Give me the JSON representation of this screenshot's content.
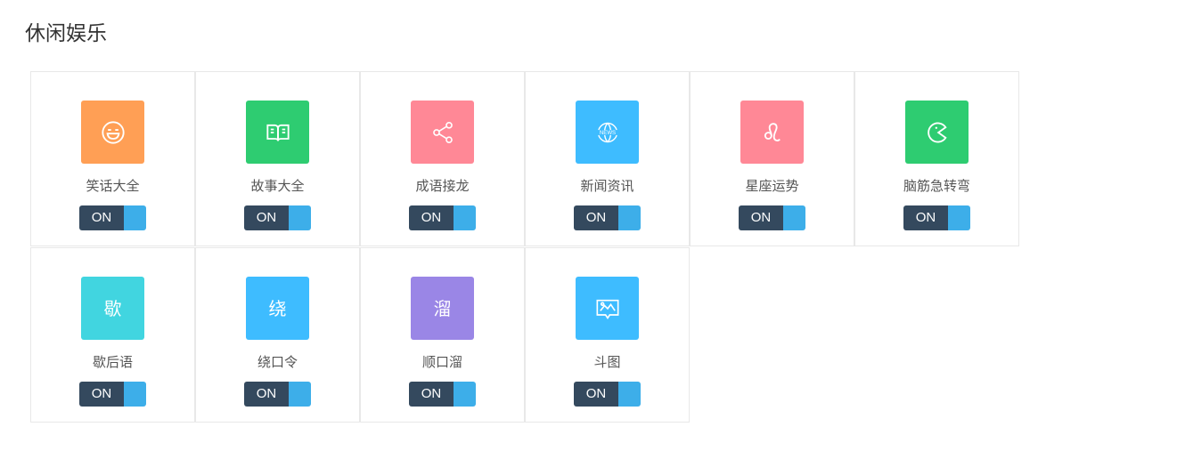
{
  "section": {
    "title": "休闲娱乐"
  },
  "items": [
    {
      "label": "笑话大全",
      "icon": "laugh-face-icon",
      "color": "#ff9f55",
      "toggle": "ON"
    },
    {
      "label": "故事大全",
      "icon": "open-book-icon",
      "color": "#2ecc71",
      "toggle": "ON"
    },
    {
      "label": "成语接龙",
      "icon": "share-nodes-icon",
      "color": "#ff8896",
      "toggle": "ON"
    },
    {
      "label": "新闻资讯",
      "icon": "news-globe-icon",
      "color": "#3ebcff",
      "toggle": "ON"
    },
    {
      "label": "星座运势",
      "icon": "leo-zodiac-icon",
      "color": "#ff8896",
      "toggle": "ON"
    },
    {
      "label": "脑筋急转弯",
      "icon": "pacman-icon",
      "color": "#2ecc71",
      "toggle": "ON"
    },
    {
      "label": "歇后语",
      "icon": "char-icon",
      "icon_text": "歇",
      "color": "#41d5e0",
      "toggle": "ON"
    },
    {
      "label": "绕口令",
      "icon": "char-icon",
      "icon_text": "绕",
      "color": "#3ebcff",
      "toggle": "ON"
    },
    {
      "label": "顺口溜",
      "icon": "char-icon",
      "icon_text": "溜",
      "color": "#9a86e6",
      "toggle": "ON"
    },
    {
      "label": "斗图",
      "icon": "image-board-icon",
      "color": "#3ebcff",
      "toggle": "ON"
    }
  ],
  "colors": {
    "toggle_on_bg": "#34495e",
    "toggle_knob": "#3daee9",
    "border": "#e8e8e8"
  }
}
